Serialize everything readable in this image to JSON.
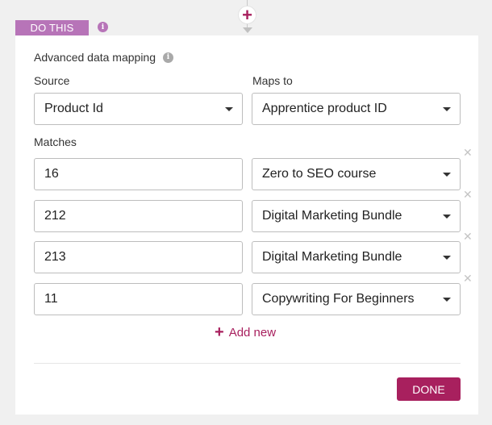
{
  "step": {
    "badge_label": "DO THIS",
    "add_step_symbol": "+"
  },
  "mapping": {
    "title": "Advanced data mapping",
    "source_label": "Source",
    "maps_to_label": "Maps to",
    "source_value": "Product Id",
    "maps_to_value": "Apprentice product ID",
    "matches_label": "Matches",
    "matches": [
      {
        "input": "16",
        "target": "Zero to SEO course"
      },
      {
        "input": "212",
        "target": "Digital Marketing Bundle"
      },
      {
        "input": "213",
        "target": "Digital Marketing Bundle"
      },
      {
        "input": "11",
        "target": "Copywriting For Beginners"
      }
    ],
    "add_new_label": "Add new",
    "done_label": "DONE"
  },
  "icons": {
    "info": "info-icon",
    "remove": "close-icon",
    "caret": "chevron-down-icon",
    "add": "plus-icon"
  },
  "colors": {
    "accent": "#a8205e",
    "badge": "#b774b8",
    "background": "#f0f0f0"
  }
}
